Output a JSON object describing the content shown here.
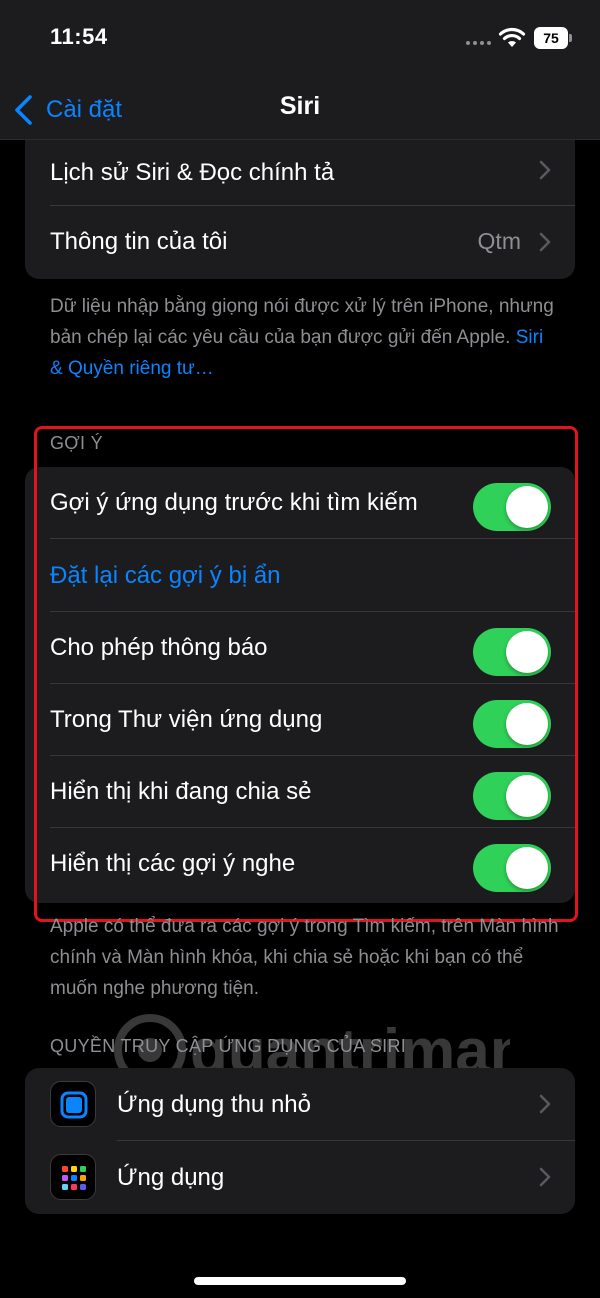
{
  "status_bar": {
    "time": "11:54",
    "battery": "75"
  },
  "nav": {
    "back_label": "Cài đặt",
    "title": "Siri"
  },
  "top_group": {
    "rows": [
      {
        "label": "Lịch sử Siri & Đọc chính tả"
      },
      {
        "label": "Thông tin của tôi",
        "value": "Qtm"
      }
    ]
  },
  "privacy_note": {
    "text": "Dữ liệu nhập bằng giọng nói được xử lý trên iPhone, nhưng bản chép lại các yêu cầu của bạn được gửi đến Apple. ",
    "link": "Siri & Quyền riêng tư…"
  },
  "suggestions": {
    "header": "GỢI Ý",
    "rows": [
      {
        "label": "Gợi ý ứng dụng trước khi tìm kiếm",
        "toggle_on": true
      },
      {
        "label": "Đặt lại các gợi ý bị ẩn"
      },
      {
        "label": "Cho phép thông báo",
        "toggle_on": true
      },
      {
        "label": "Trong Thư viện ứng dụng",
        "toggle_on": true
      },
      {
        "label": "Hiển thị khi đang chia sẻ",
        "toggle_on": true
      },
      {
        "label": "Hiển thị các gợi ý nghe",
        "toggle_on": true
      }
    ],
    "footer": "Apple có thể đưa ra các gợi ý trong Tìm kiếm, trên Màn hình chính và Màn hình khóa, khi chia sẻ hoặc khi bạn có thể muốn nghe phương tiện."
  },
  "app_access": {
    "header": "QUYỀN TRUY CẬP ỨNG DỤNG CỦA SIRI",
    "rows": [
      {
        "label": "Ứng dụng thu nhỏ",
        "icon": "app-clips-icon"
      },
      {
        "label": "Ứng dụng",
        "icon": "app-grid-icon"
      }
    ]
  },
  "watermark": "quantrimang",
  "colors": {
    "accent": "#0a84ff",
    "toggle_on": "#30d158",
    "highlight": "#e0141e"
  }
}
